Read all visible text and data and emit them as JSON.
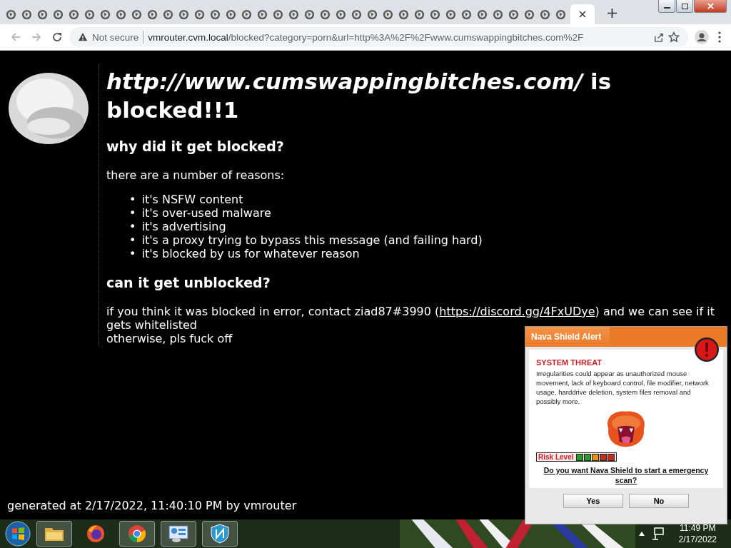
{
  "browser": {
    "tabs": [
      {
        "selected": false
      },
      {
        "selected": false
      },
      {
        "selected": false
      },
      {
        "selected": false
      },
      {
        "selected": false
      },
      {
        "selected": false
      },
      {
        "selected": false
      },
      {
        "selected": false
      },
      {
        "selected": false
      },
      {
        "selected": false
      },
      {
        "selected": false
      },
      {
        "selected": false
      },
      {
        "selected": false
      },
      {
        "selected": false
      },
      {
        "selected": false
      },
      {
        "selected": false
      },
      {
        "selected": false
      },
      {
        "selected": false
      },
      {
        "selected": false
      },
      {
        "selected": false
      },
      {
        "selected": false
      },
      {
        "selected": false
      },
      {
        "selected": false
      },
      {
        "selected": false
      },
      {
        "selected": false
      },
      {
        "selected": false
      },
      {
        "selected": false
      },
      {
        "selected": false
      },
      {
        "selected": false
      },
      {
        "selected": false
      },
      {
        "selected": false
      },
      {
        "selected": false
      },
      {
        "selected": false
      },
      {
        "selected": false
      },
      {
        "selected": false
      },
      {
        "selected": false
      },
      {
        "selected": true
      }
    ],
    "security": "Not secure",
    "url_host": "vmrouter.cvm.local",
    "url_path": "/blocked?category=porn&url=http%3A%2F%2Fwww.cumswappingbitches.com%2F"
  },
  "page": {
    "heading": "*http://www.cumswappingbitches.com/* is blocked!!1",
    "section_1": "why did it get blocked?",
    "intro": "there are a number of reasons:",
    "reasons": [
      {
        "marker": "•",
        "text": "it's NSFW content"
      },
      {
        "marker": "•",
        "text": "it's over-used malware"
      },
      {
        "marker": "•",
        "text": "it's advertising"
      },
      {
        "marker": "•",
        "text": "it's a proxy trying to bypass this message (and failing hard)"
      },
      {
        "marker": "•",
        "text": "it's blocked by us for whatever reason"
      }
    ],
    "section_2": "can it get unblocked?",
    "contact_before": "if you think it was blocked in error, contact ziad87#3990 (",
    "contact_link": "https://discord.gg/4FxUDye",
    "contact_after": ") and we can see if it gets whitelisted",
    "closing": "otherwise, pls fuck off",
    "footer": "generated at 2/17/2022, 11:40:10 PM by vmrouter"
  },
  "alert": {
    "title": "Nava Shield Alert",
    "threat": "SYSTEM THREAT",
    "message": "Irregularities could appear as unauthorized mouse movement, lack of keyboard control, file modifier, network usage, harddrive deletion, system files removal and possibly more.",
    "risk_label": "Risk Level",
    "risk_segments": [
      {
        "color": "#2e9a2e"
      },
      {
        "color": "#2e9a2e"
      },
      {
        "color": "#e8901a"
      },
      {
        "color": "#c0301c"
      },
      {
        "color": "#c0301c"
      }
    ],
    "question": "Do you want Nava Shield to start a emergency scan?",
    "buttons": [
      "Yes",
      "No"
    ]
  },
  "taskbar": {
    "time": "11:49 PM",
    "date": "2/17/2022"
  }
}
